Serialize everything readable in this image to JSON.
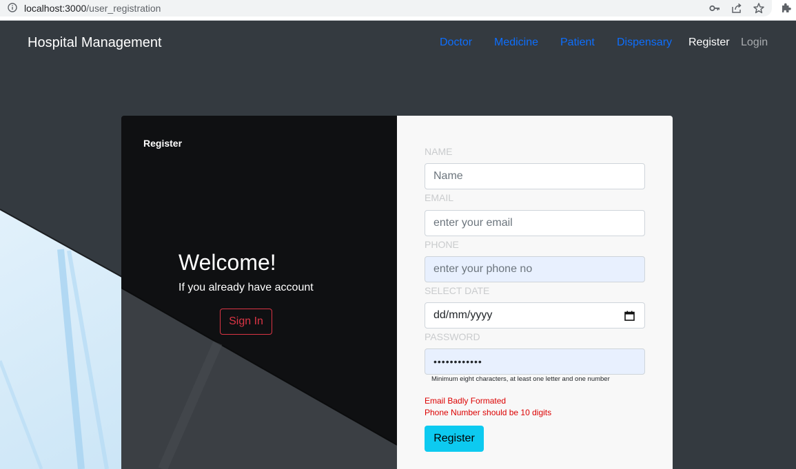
{
  "browser": {
    "url_host": "localhost:3000",
    "url_path": "/user_registration",
    "icons": [
      "info-icon",
      "key-icon",
      "share-icon",
      "star-icon",
      "extensions-icon"
    ]
  },
  "navbar": {
    "brand": "Hospital Management",
    "links": [
      "Doctor",
      "Medicine",
      "Patient",
      "Dispensary"
    ],
    "register": "Register",
    "login": "Login"
  },
  "left_panel": {
    "title": "Register",
    "welcome": "Welcome!",
    "subtitle": "If you already have account",
    "signin_label": "Sign In"
  },
  "form": {
    "name_label": "NAME",
    "name_placeholder": "Name",
    "email_label": "EMAIL",
    "email_placeholder": "enter your email",
    "phone_label": "PHONE",
    "phone_placeholder": "enter your phone no",
    "date_label": "SELECT DATE",
    "date_value": "dd/mm/yyyy",
    "password_label": "PASSWORD",
    "password_value": "••••••••••••",
    "password_hint": "Minimum eight characters, at least one letter and one number",
    "errors": [
      "Email Badly Formated",
      "Phone Number should be 10 digits"
    ],
    "submit_label": "Register"
  },
  "colors": {
    "nav_link": "#0d6efd",
    "error": "#dc0000",
    "signin_outline": "#dc3545",
    "register_button": "#0dcaf0",
    "page_bg": "#343a40"
  }
}
